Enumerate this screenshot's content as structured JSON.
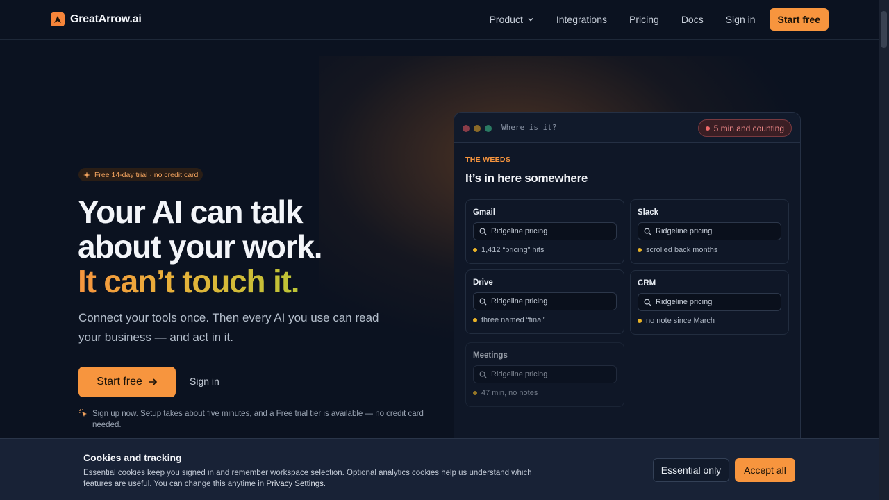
{
  "brand": {
    "name": "GreatArrow.ai",
    "accent": "#f7953e"
  },
  "nav": {
    "links": [
      {
        "label": "Product",
        "has_dropdown": true
      },
      {
        "label": "Integrations"
      },
      {
        "label": "Pricing"
      },
      {
        "label": "Docs"
      },
      {
        "label": "Sign in"
      }
    ],
    "cta": "Start free"
  },
  "hero": {
    "badge": "Free 14-day trial · no credit card",
    "headline_line1": "Your AI can talk",
    "headline_line2": "about your work.",
    "headline_accent": "It can’t touch it.",
    "subtitle": "Connect your tools once. Then every AI you use can read your business — and act in it.",
    "primary_cta": "Start free",
    "secondary_cta": "Sign in",
    "note": "Sign up now. Setup takes about five minutes, and a Free trial tier is available — no credit card needed."
  },
  "mock": {
    "window_title": "Where is it?",
    "timer": "5 min and counting",
    "kicker": "THE WEEDS",
    "heading": "It’s in here somewhere",
    "cards": [
      {
        "title": "Gmail",
        "query": "Ridgeline pricing",
        "status": "1,412 “pricing” hits"
      },
      {
        "title": "Slack",
        "query": "Ridgeline pricing",
        "status": "scrolled back months"
      },
      {
        "title": "Drive",
        "query": "Ridgeline pricing",
        "status": "three named “final”"
      },
      {
        "title": "CRM",
        "query": "Ridgeline pricing",
        "status": "no note since March"
      },
      {
        "title": "Meetings",
        "query": "Ridgeline pricing",
        "status": "47 min, no notes"
      }
    ]
  },
  "cookies": {
    "title": "Cookies and tracking",
    "text": "Essential cookies keep you signed in and remember workspace selection. Optional analytics cookies help us understand which features are useful. You can change this anytime in",
    "link": "Privacy Settings",
    "essential_button": "Essential only",
    "accept_button": "Accept all"
  }
}
